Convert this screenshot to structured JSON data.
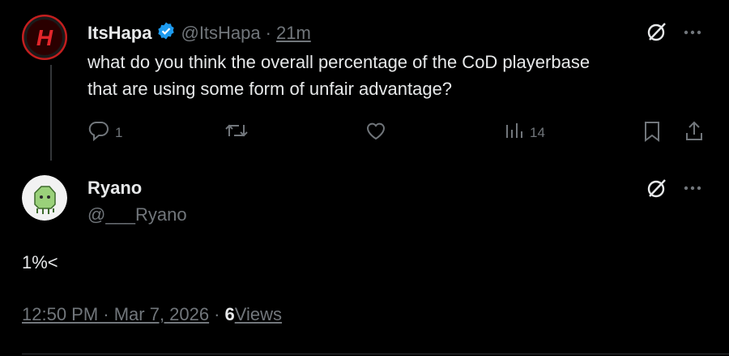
{
  "parent_tweet": {
    "author_name": "ItsHapa",
    "handle": "@ItsHapa",
    "separator": "·",
    "time_ago": "21m",
    "text_line1": "what do you think the overall percentage of the CoD playerbase",
    "text_line2": "that are using some form of unfair advantage?",
    "reply_count": "1",
    "views_count": "14"
  },
  "reply_tweet": {
    "author_name": "Ryano",
    "handle": "@___Ryano",
    "text": "1%<",
    "timestamp": "12:50 PM · Mar 7, 2026",
    "dot": "·",
    "views_number": "6",
    "views_label": " Views"
  },
  "colors": {
    "background": "#000000",
    "text": "#e7e9ea",
    "muted": "#71767b",
    "verified": "#1d9bf0",
    "divider": "#2f3336"
  },
  "icons": [
    "verified-badge-icon",
    "grok-icon",
    "more-icon",
    "reply-icon",
    "retweet-icon",
    "like-icon",
    "views-icon",
    "bookmark-icon",
    "share-icon"
  ]
}
